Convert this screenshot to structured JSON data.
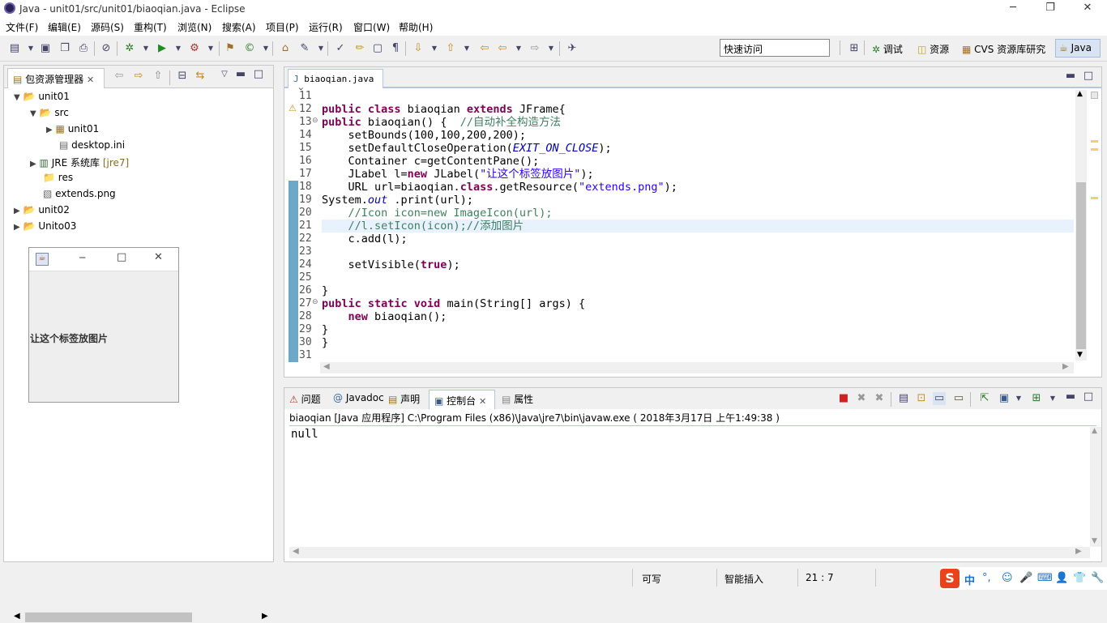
{
  "window": {
    "title": "Java  -  unit01/src/unit01/biaoqian.java  -  Eclipse"
  },
  "menu": [
    "文件(F)",
    "编辑(E)",
    "源码(S)",
    "重构(T)",
    "浏览(N)",
    "搜索(A)",
    "项目(P)",
    "运行(R)",
    "窗口(W)",
    "帮助(H)"
  ],
  "toolbar": {
    "quick_access_placeholder": "快速访问"
  },
  "perspectives": {
    "debug": "调试",
    "resource": "资源",
    "cvs": "CVS 资源库研究",
    "java": "Java"
  },
  "package_explorer": {
    "tab": "包资源管理器",
    "tree": [
      {
        "label": "unit01"
      },
      {
        "label": "src"
      },
      {
        "label": "unit01"
      },
      {
        "label": "desktop.ini"
      },
      {
        "label": "JRE 系统库",
        "suffix": "[jre7]"
      },
      {
        "label": "res"
      },
      {
        "label": "extends.png"
      },
      {
        "label": "unit02"
      },
      {
        "label": "Unito03"
      }
    ]
  },
  "swing_window": {
    "label": "让这个标签放图片"
  },
  "editor": {
    "tab": "biaoqian.java",
    "line_numbers": [
      "11",
      "12",
      "13",
      "14",
      "15",
      "16",
      "17",
      "18",
      "19",
      "20",
      "21",
      "22",
      "23",
      "24",
      "25",
      "26",
      "27",
      "28",
      "29",
      "30",
      "31"
    ]
  },
  "console": {
    "tabs": {
      "problems": "问题",
      "javadoc": "Javadoc",
      "declaration": "声明",
      "console": "控制台",
      "properties": "属性"
    },
    "header": "biaoqian [Java 应用程序] C:\\Program Files (x86)\\Java\\jre7\\bin\\javaw.exe ( 2018年3月17日 上午1:49:38 )",
    "output": "null"
  },
  "status": {
    "writable": "可写",
    "insert_mode": "智能插入",
    "position": "21 : 7"
  },
  "ime": {
    "mode": "中"
  }
}
